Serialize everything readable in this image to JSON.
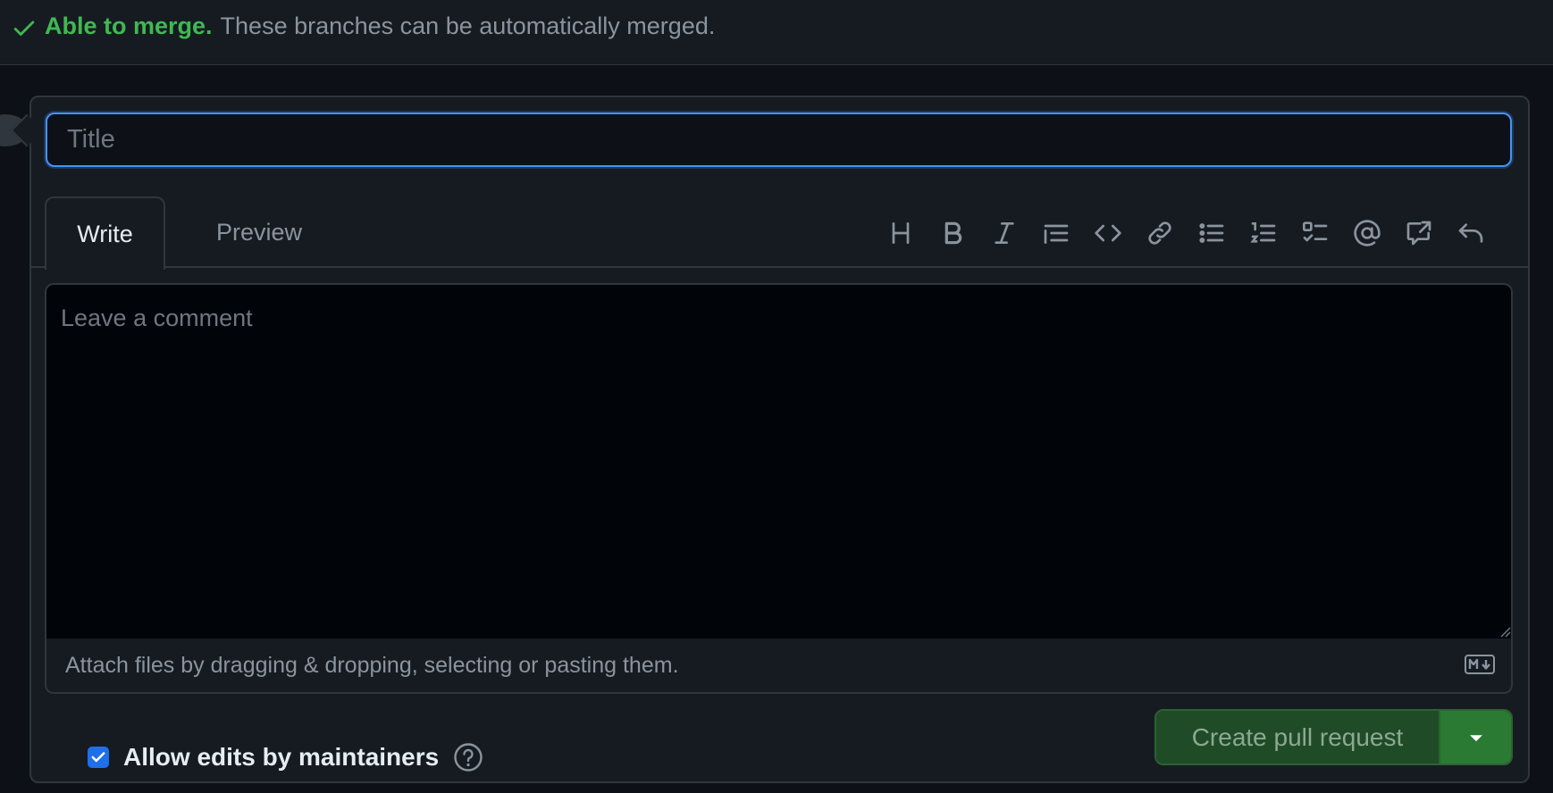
{
  "merge_status": {
    "status_label": "Able to merge.",
    "message": "These branches can be automatically merged.",
    "icon": "check-icon",
    "color": "#3fb950"
  },
  "form": {
    "title_placeholder": "Title",
    "tabs": [
      {
        "label": "Write",
        "active": true
      },
      {
        "label": "Preview",
        "active": false
      }
    ],
    "toolbar_icons": [
      "heading-icon",
      "bold-icon",
      "italic-icon",
      "quote-icon",
      "code-icon",
      "link-icon",
      "unordered-list-icon",
      "ordered-list-icon",
      "task-list-icon",
      "mention-icon",
      "cross-reference-icon",
      "undo-icon"
    ],
    "comment_placeholder": "Leave a comment",
    "attach_text": "Attach files by dragging & dropping, selecting or pasting them.",
    "markdown_icon": "markdown-icon"
  },
  "footer": {
    "allow_edits_label": "Allow edits by maintainers",
    "allow_edits_checked": true,
    "create_button_label": "Create pull request",
    "create_button_color": "#238636"
  },
  "colors": {
    "background": "#0d1117",
    "accent": "#4493f8",
    "muted": "#8b949e"
  }
}
